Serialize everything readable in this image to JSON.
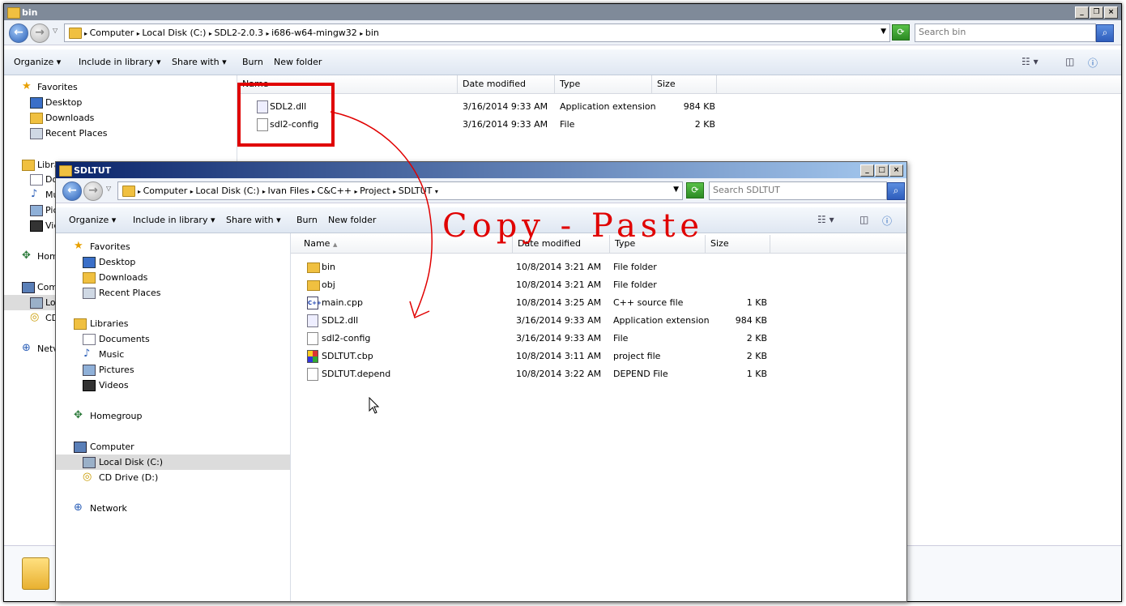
{
  "outer": {
    "title": "bin",
    "breadcrumb": [
      "Computer",
      "Local Disk (C:)",
      "SDL2-2.0.3",
      "i686-w64-mingw32",
      "bin"
    ],
    "search_placeholder": "Search bin",
    "toolbar": [
      "Organize",
      "Include in library",
      "Share with",
      "Burn",
      "New folder"
    ],
    "nav": {
      "favorites": "Favorites",
      "fav_items": [
        "Desktop",
        "Downloads",
        "Recent Places"
      ],
      "partial": [
        "Libra",
        "Do",
        "Mu",
        "Pic",
        "Vic",
        "Hom",
        "Com",
        "Lo",
        "CD",
        "Netv"
      ]
    },
    "columns": [
      "Name",
      "Date modified",
      "Type",
      "Size"
    ],
    "files": [
      {
        "name": "SDL2.dll",
        "date": "3/16/2014 9:33 AM",
        "type": "Application extension",
        "size": "984 KB",
        "icon": "dll-icon"
      },
      {
        "name": "sdl2-config",
        "date": "3/16/2014 9:33 AM",
        "type": "File",
        "size": "2 KB",
        "icon": "file-icon"
      }
    ]
  },
  "inner": {
    "title": "SDLTUT",
    "breadcrumb": [
      "Computer",
      "Local Disk (C:)",
      "Ivan Files",
      "C&C++",
      "Project",
      "SDLTUT"
    ],
    "search_placeholder": "Search SDLTUT",
    "toolbar": [
      "Organize",
      "Include in library",
      "Share with",
      "Burn",
      "New folder"
    ],
    "nav": {
      "favorites": "Favorites",
      "fav_items": [
        "Desktop",
        "Downloads",
        "Recent Places"
      ],
      "libraries": "Libraries",
      "lib_items": [
        "Documents",
        "Music",
        "Pictures",
        "Videos"
      ],
      "homegroup": "Homegroup",
      "computer": "Computer",
      "comp_items": [
        "Local Disk (C:)",
        "CD Drive (D:)"
      ],
      "network": "Network"
    },
    "columns": [
      "Name",
      "Date modified",
      "Type",
      "Size"
    ],
    "files": [
      {
        "name": "bin",
        "date": "10/8/2014 3:21 AM",
        "type": "File folder",
        "size": "",
        "icon": "folder-icon"
      },
      {
        "name": "obj",
        "date": "10/8/2014 3:21 AM",
        "type": "File folder",
        "size": "",
        "icon": "folder-icon"
      },
      {
        "name": "main.cpp",
        "date": "10/8/2014 3:25 AM",
        "type": "C++ source file",
        "size": "1 KB",
        "icon": "cpp-icon"
      },
      {
        "name": "SDL2.dll",
        "date": "3/16/2014 9:33 AM",
        "type": "Application extension",
        "size": "984 KB",
        "icon": "dll-icon"
      },
      {
        "name": "sdl2-config",
        "date": "3/16/2014 9:33 AM",
        "type": "File",
        "size": "2 KB",
        "icon": "file-icon"
      },
      {
        "name": "SDLTUT.cbp",
        "date": "10/8/2014 3:11 AM",
        "type": "project file",
        "size": "2 KB",
        "icon": "cbp-icon"
      },
      {
        "name": "SDLTUT.depend",
        "date": "10/8/2014 3:22 AM",
        "type": "DEPEND File",
        "size": "1 KB",
        "icon": "file-icon"
      }
    ]
  },
  "annotation": {
    "text": "Copy - Paste",
    "color": "#e00000"
  }
}
